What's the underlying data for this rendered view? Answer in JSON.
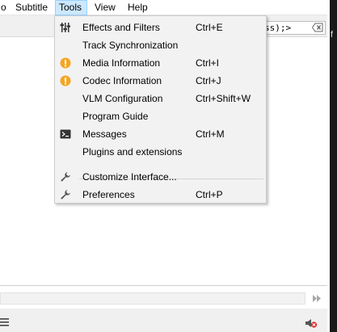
{
  "menubar": {
    "items": [
      {
        "label": "o"
      },
      {
        "label": "Subtitle"
      },
      {
        "label": "Tools"
      },
      {
        "label": "View"
      },
      {
        "label": "Help"
      }
    ]
  },
  "toolbar": {
    "search_value": "ss);>"
  },
  "tools_menu": {
    "items": [
      {
        "label": "Effects and Filters",
        "shortcut": "Ctrl+E",
        "icon": "equalizer-icon"
      },
      {
        "label": "Track Synchronization",
        "shortcut": "",
        "icon": ""
      },
      {
        "label": "Media Information",
        "shortcut": "Ctrl+I",
        "icon": "info-icon"
      },
      {
        "label": "Codec Information",
        "shortcut": "Ctrl+J",
        "icon": "info-icon"
      },
      {
        "label": "VLM Configuration",
        "shortcut": "Ctrl+Shift+W",
        "icon": ""
      },
      {
        "label": "Program Guide",
        "shortcut": "",
        "icon": ""
      },
      {
        "label": "Messages",
        "shortcut": "Ctrl+M",
        "icon": "terminal-icon"
      },
      {
        "label": "Plugins and extensions",
        "shortcut": "",
        "icon": ""
      },
      {
        "label": "Customize Interface...",
        "shortcut": "",
        "icon": "wrench-icon"
      },
      {
        "label": "Preferences",
        "shortcut": "Ctrl+P",
        "icon": "wrench-icon"
      }
    ]
  },
  "right_edge_text": "f",
  "colors": {
    "menu_active_bg": "#cce8ff",
    "menu_active_border": "#99d1ff",
    "info_icon_orange": "#f5a623",
    "mute_red": "#e02020"
  }
}
